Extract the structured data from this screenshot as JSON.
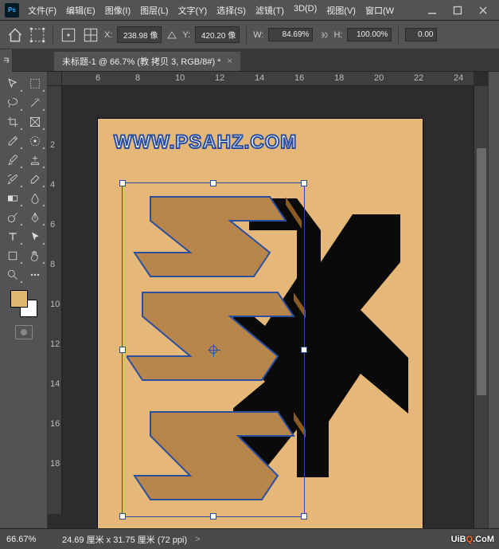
{
  "menu": {
    "items": [
      "文件(F)",
      "编辑(E)",
      "图像(I)",
      "图层(L)",
      "文字(Y)",
      "选择(S)",
      "滤镜(T)",
      "3D(D)",
      "视图(V)",
      "窗口(W"
    ]
  },
  "options": {
    "x_label": "X:",
    "x_value": "238.98 像",
    "y_label": "Y:",
    "y_value": "420.20 像",
    "w_label": "W:",
    "w_value": "84.69%",
    "h_label": "H:",
    "h_value": "100.00%",
    "angle_value": "0.00"
  },
  "tab": {
    "title": "未标题-1 @ 66.7% (教 拷贝 3, RGB/8#) *",
    "close": "×"
  },
  "ruler_h": [
    "6",
    "8",
    "10",
    "12",
    "14",
    "16",
    "18",
    "20",
    "22",
    "24"
  ],
  "ruler_v": [
    "2",
    "4",
    "6",
    "8",
    "10",
    "12",
    "14",
    "16",
    "18"
  ],
  "artboard": {
    "watermark": "WWW.PSAHZ.COM"
  },
  "status": {
    "zoom": "66.67%",
    "dims": "24.69 厘米 x 31.75 厘米 (72 ppi)",
    "caret": ">"
  },
  "colors": {
    "fg": "#e2b673",
    "bg": "#ffffff",
    "canvas": "#e5b879"
  },
  "brand": {
    "text": "UiBQ.CoM"
  }
}
